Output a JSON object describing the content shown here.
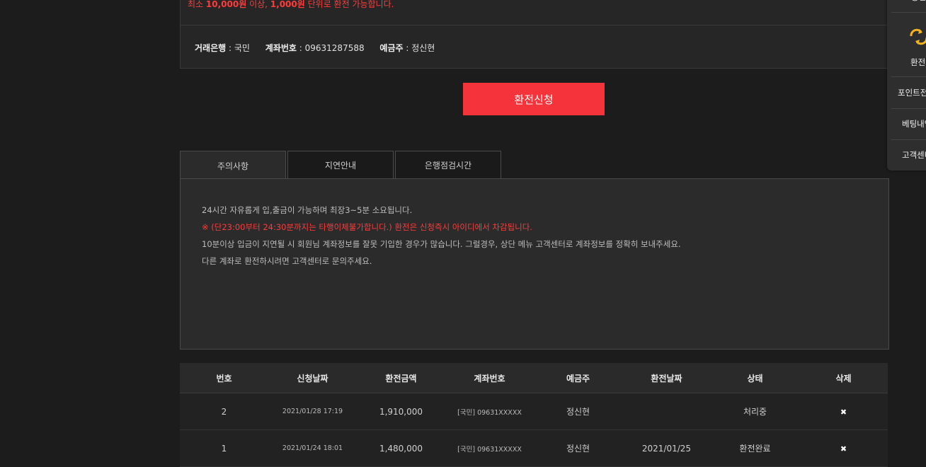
{
  "notice_top": {
    "min_prefix": "최소 ",
    "min_amount": "10,000원",
    "mid": " 이상, ",
    "unit_amount": "1,000원",
    "suffix": " 단위로 환전 가능합니다."
  },
  "bank_info": {
    "bank_label": "거래은행",
    "bank_value": "국민",
    "account_label": "계좌번호",
    "account_value": "09631287588",
    "holder_label": "예금주",
    "holder_value": "정신현"
  },
  "submit_button": "환전신청",
  "tabs": [
    {
      "label": "주의사항",
      "active": true
    },
    {
      "label": "지연안내",
      "active": false
    },
    {
      "label": "은행점검시간",
      "active": false
    }
  ],
  "notice_lines": [
    "24시간 자유롭게 입,출금이 가능하며 최장3~5분 소요됩니다.",
    "※ (단23:00부터 24:30분까지는 타행이체불가합니다.) 환전은 신청즉시 아이디에서 차감됩니다.",
    "10분이상 입금이 지연될 시 회원님 계좌정보를 잘못 기입한 경우가 많습니다. 그럴경우, 상단 메뉴 고객센터로 계좌정보를 정확히 보내주세요.",
    "다른 계좌로 환전하시려면 고객센터로 문의주세요."
  ],
  "table": {
    "headers": [
      "번호",
      "신청날짜",
      "환전금액",
      "계좌번호",
      "예금주",
      "환전날짜",
      "상태",
      "삭제"
    ],
    "rows": [
      {
        "no": "2",
        "request_date": "2021/01/28 17:19",
        "amount": "1,910,000",
        "account": "[국민] 09631XXXXX",
        "holder": "정신현",
        "exchange_date": "",
        "status": "처리중",
        "delete": "✖"
      },
      {
        "no": "1",
        "request_date": "2021/01/24 18:01",
        "amount": "1,480,000",
        "account": "[국민] 09631XXXXX",
        "holder": "정신현",
        "exchange_date": "2021/01/25",
        "status": "환전완료",
        "delete": "✖"
      }
    ]
  },
  "side_menu": {
    "top_partial": "충전",
    "exchange_icon": "exchange-icon",
    "items": [
      "환전",
      "포인트전환",
      "베팅내역",
      "고객센터"
    ]
  },
  "colors": {
    "accent_red": "#f5333a",
    "icon_gold": "#f5b321"
  }
}
